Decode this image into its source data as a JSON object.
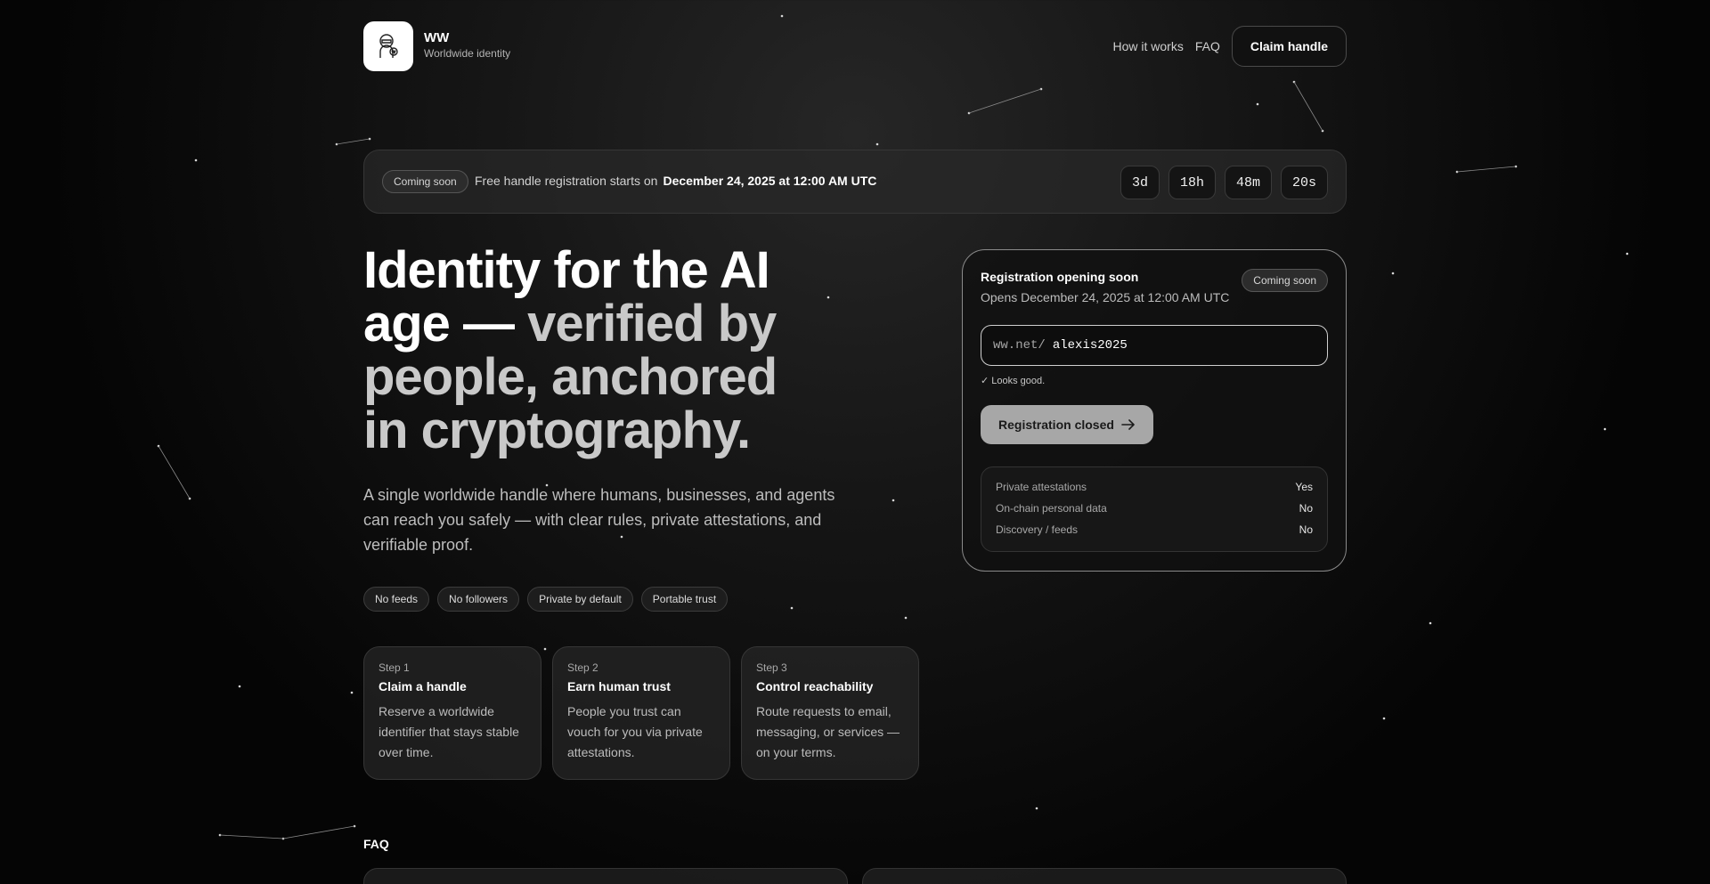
{
  "header": {
    "brand_name": "WW",
    "brand_tagline": "Worldwide identity",
    "nav": [
      {
        "label": "How it works"
      },
      {
        "label": "FAQ"
      }
    ],
    "cta_label": "Claim handle"
  },
  "banner": {
    "badge": "Coming soon",
    "text": "Free handle registration starts on",
    "date": "December 24, 2025 at 12:00 AM UTC",
    "countdown": [
      "3d",
      "18h",
      "48m",
      "20s"
    ]
  },
  "hero": {
    "title_line1": "Identity for the AI",
    "title_line2_white": "age — ",
    "title_line2_gray": "verified by",
    "title_line3": "people, anchored",
    "title_line4": "in cryptography.",
    "subtitle": "A single worldwide handle where humans, businesses, and agents can reach you safely — with clear rules, private attestations, and verifiable proof.",
    "tags": [
      "No feeds",
      "No followers",
      "Private by default",
      "Portable trust"
    ]
  },
  "steps": [
    {
      "number": "Step 1",
      "title": "Claim a handle",
      "description": "Reserve a worldwide identifier that stays stable over time."
    },
    {
      "number": "Step 2",
      "title": "Earn human trust",
      "description": "People you trust can vouch for you via private attestations."
    },
    {
      "number": "Step 3",
      "title": "Control reachability",
      "description": "Route requests to email, messaging, or services — on your terms."
    }
  ],
  "registration": {
    "title": "Registration opening soon",
    "opens": "Opens December 24, 2025 at 12:00 AM UTC",
    "badge": "Coming soon",
    "input_prefix": "ww.net/",
    "input_value": "alexis2025",
    "hint": "✓ Looks good.",
    "button_label": "Registration closed",
    "button_icon": "arrow-right-icon",
    "facts": [
      {
        "label": "Private attestations",
        "value": "Yes"
      },
      {
        "label": "On-chain personal data",
        "value": "No"
      },
      {
        "label": "Discovery / feeds",
        "value": "No"
      }
    ]
  },
  "faq": {
    "heading": "FAQ"
  },
  "colors": {
    "background": "#0a0a0a",
    "card_border": "#8a8a8a",
    "button_disabled": "#a7a7a7"
  }
}
